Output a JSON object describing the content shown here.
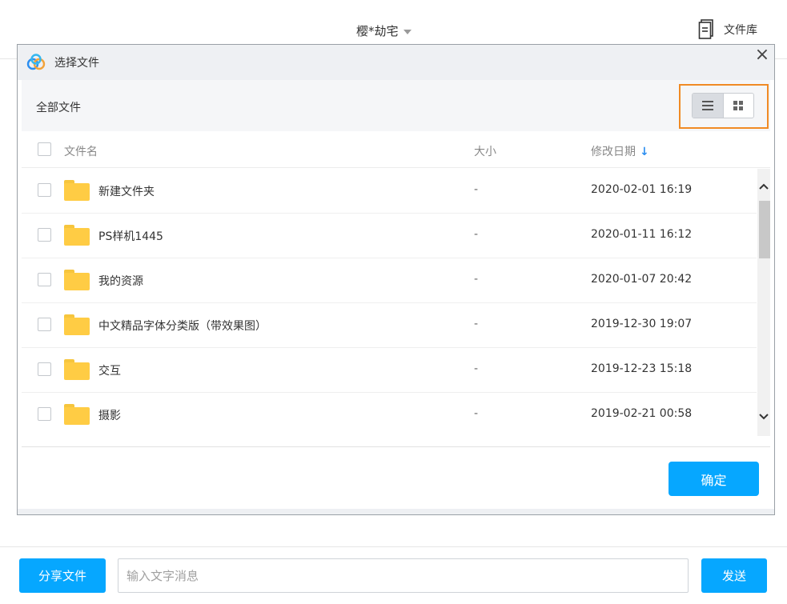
{
  "header": {
    "chat_title": "樱*劫宅",
    "library_label": "文件库"
  },
  "modal": {
    "title": "选择文件",
    "path": "全部文件",
    "columns": {
      "name": "文件名",
      "size": "大小",
      "modified": "修改日期"
    },
    "view_mode": "list",
    "rows": [
      {
        "name": "新建文件夹",
        "size": "-",
        "modified": "2020-02-01 16:19",
        "icon": "folder-icon"
      },
      {
        "name": "PS样机1445",
        "size": "-",
        "modified": "2020-01-11 16:12",
        "icon": "folder-icon"
      },
      {
        "name": "我的资源",
        "size": "-",
        "modified": "2020-01-07 20:42",
        "icon": "folder-icon"
      },
      {
        "name": "中文精品字体分类版（带效果图）",
        "size": "-",
        "modified": "2019-12-30 19:07",
        "icon": "folder-icon"
      },
      {
        "name": "交互",
        "size": "-",
        "modified": "2019-12-23 15:18",
        "icon": "folder-icon"
      },
      {
        "name": "摄影",
        "size": "-",
        "modified": "2019-02-21 00:58",
        "icon": "folder-icon"
      }
    ],
    "confirm_label": "确定"
  },
  "composer": {
    "share_label": "分享文件",
    "input_placeholder": "输入文字消息",
    "input_value": "",
    "send_label": "发送"
  },
  "colors": {
    "accent": "#06a7ff",
    "highlight_border": "#f08a24",
    "folder": "#ffcc44"
  }
}
